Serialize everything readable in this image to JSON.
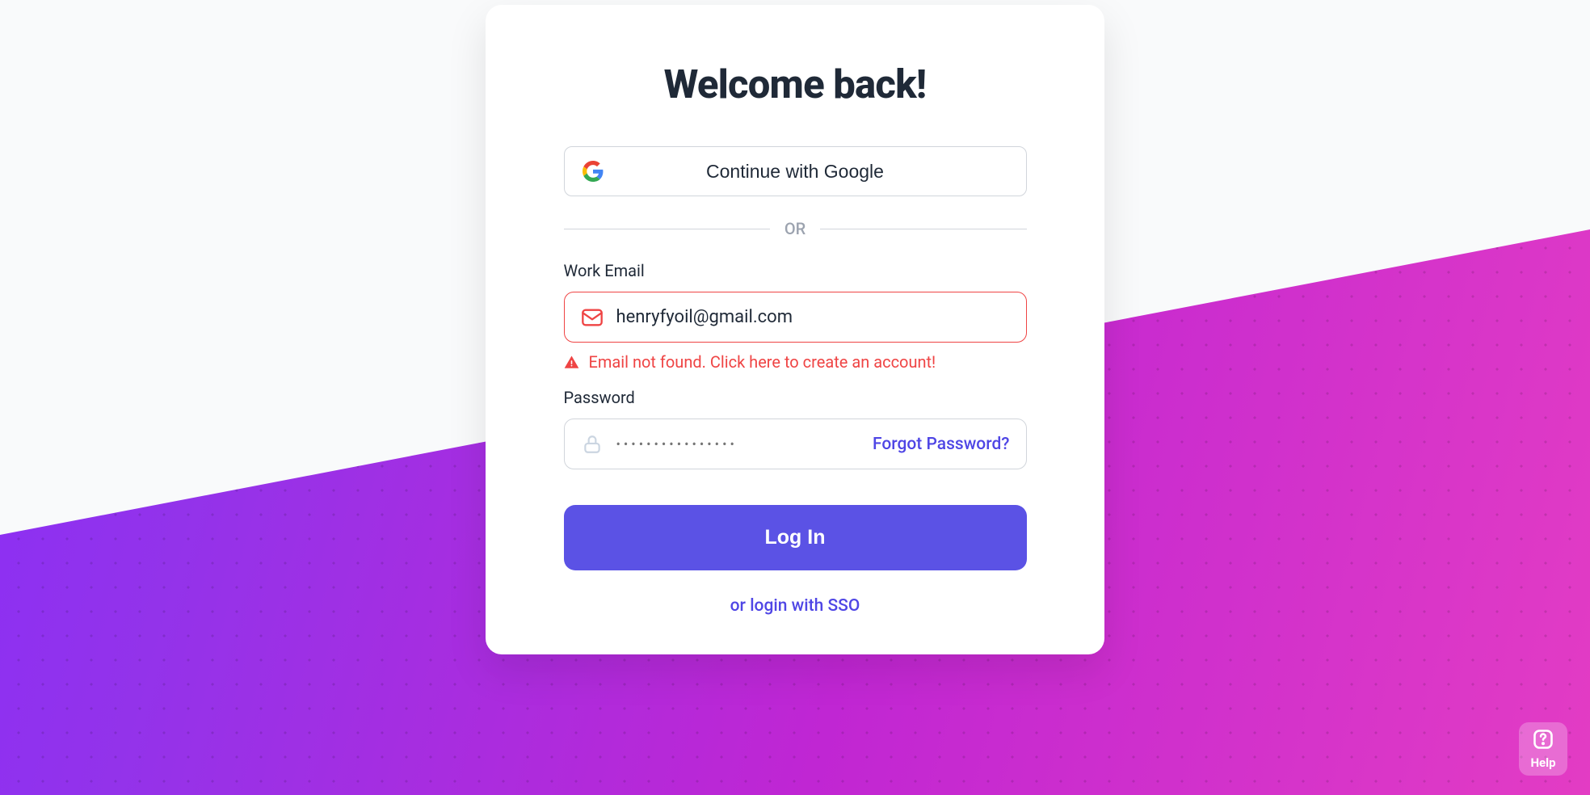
{
  "title": "Welcome back!",
  "google_button": "Continue with Google",
  "divider": "OR",
  "email": {
    "label": "Work Email",
    "value": "henryfyoil@gmail.com",
    "error": "Email not found. Click here to create an account!"
  },
  "password": {
    "label": "Password",
    "placeholder": "••••••••••••••••",
    "forgot": "Forgot Password?"
  },
  "login_button": "Log In",
  "sso_link": "or login with SSO",
  "help": {
    "label": "Help"
  },
  "colors": {
    "error": "#ef4444",
    "primary": "#5b52e5",
    "link": "#4f46e5"
  }
}
